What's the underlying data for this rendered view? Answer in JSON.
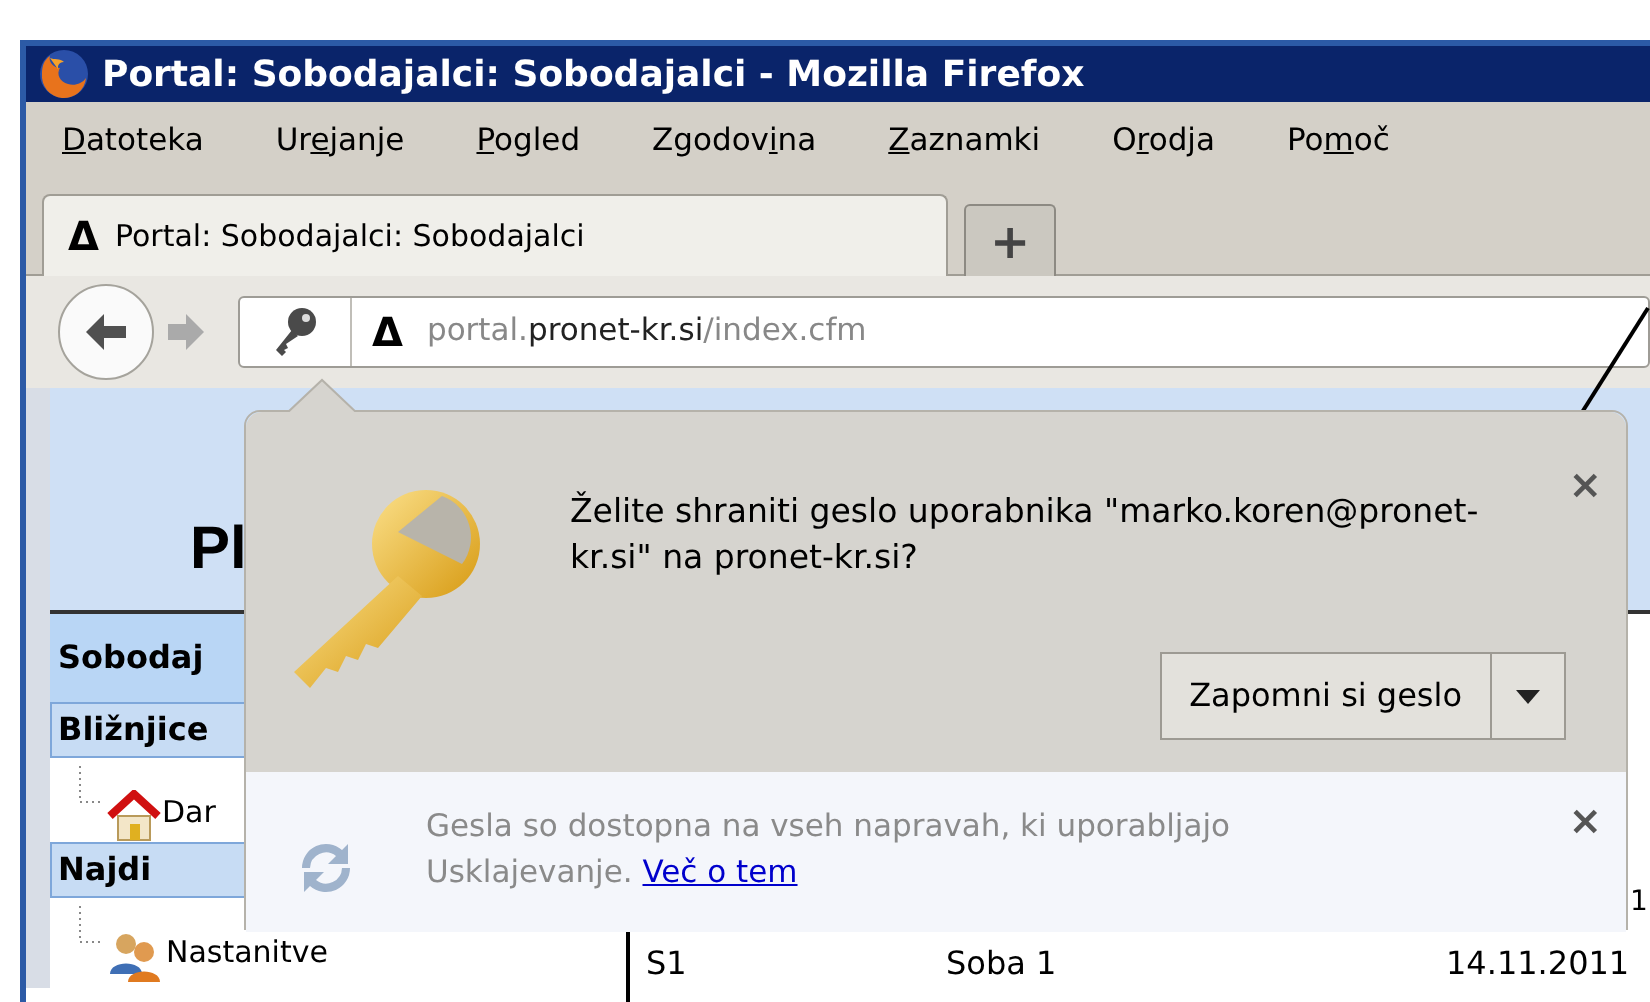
{
  "window": {
    "title": "Portal: Sobodajalci: Sobodajalci - Mozilla Firefox"
  },
  "menu": [
    {
      "key": "D",
      "after": "atoteka"
    },
    {
      "before": "Ur",
      "key": "e",
      "after": "janje"
    },
    {
      "key": "P",
      "after": "ogled"
    },
    {
      "before": "Zgodov",
      "key": "i",
      "after": "na"
    },
    {
      "key": "Z",
      "after": "aznamki"
    },
    {
      "before": "O",
      "key": "r",
      "after": "odja"
    },
    {
      "before": "Po",
      "key": "m",
      "after": "oč"
    }
  ],
  "tabs": [
    {
      "icon": "Δ",
      "label": "Portal: Sobodajalci: Sobodajalci",
      "selected": true
    }
  ],
  "new_tab": "+",
  "address_bar": {
    "site_icon": "Δ",
    "prefix": "portal.",
    "domain": "pronet-kr.si",
    "path": "/index.cfm"
  },
  "page": {
    "heading": "Pl",
    "sidebar": [
      {
        "kind": "header",
        "label": "Sobodaj"
      },
      {
        "kind": "section",
        "label": "Bližnjice"
      },
      {
        "kind": "home",
        "label": "Dar"
      },
      {
        "kind": "section",
        "label": "Najdi"
      },
      {
        "kind": "people",
        "label": "Nastanitve"
      }
    ],
    "edge_cell": "1",
    "rows": [
      {
        "cells": [
          "S1",
          "Soba 1",
          "14.11.2011"
        ]
      }
    ]
  },
  "popup": {
    "message": "Želite shraniti geslo uporabnika \"marko.koren@pronet-kr.si\" na pronet-kr.si?",
    "close": "×",
    "button": "Zapomni si geslo",
    "footer": {
      "text": "Gesla so dostopna na vseh napravah, ki uporabljajo Usklajevanje.",
      "link": "Več o tem",
      "close": "×"
    }
  }
}
